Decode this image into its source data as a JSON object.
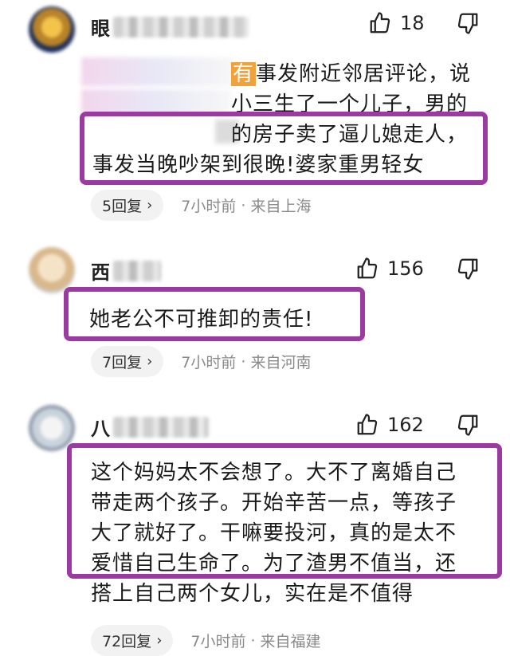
{
  "comments": [
    {
      "name_visible": "眼",
      "likes": "18",
      "text_lines": [
        "事发附近邻居评论，说",
        "小三生了一个儿子，男的",
        "的房子卖了逼儿媳走人，",
        "事发当晚吵架到很晚!婆家重男轻女"
      ],
      "prefix_char": "有",
      "reply_label": "5回复",
      "time": "7小时前",
      "location": "来自上海"
    },
    {
      "name_visible": "西",
      "likes": "156",
      "text_lines": [
        "她老公不可推卸的责任!"
      ],
      "reply_label": "7回复",
      "time": "7小时前",
      "location": "来自河南"
    },
    {
      "name_visible": "八",
      "likes": "162",
      "text_lines": [
        "这个妈妈太不会想了。大不了离婚自己",
        "带走两个孩子。开始辛苦一点，等孩子",
        "大了就好了。干嘛要投河，真的是太不",
        "爱惜自己生命了。为了渣男不值当，还",
        "搭上自己两个女儿，实在是不值得"
      ],
      "reply_label": "72回复",
      "time": "7小时前",
      "location": "来自福建"
    }
  ],
  "meta": {
    "separator": "·",
    "chevron": "›"
  },
  "colors": {
    "highlight_border": "#9b3aa0",
    "meta_text": "#8a8a8a",
    "pill_bg": "#f2f2f2"
  },
  "icons": {
    "like": "thumbs-up-icon",
    "dislike": "thumbs-down-icon"
  }
}
